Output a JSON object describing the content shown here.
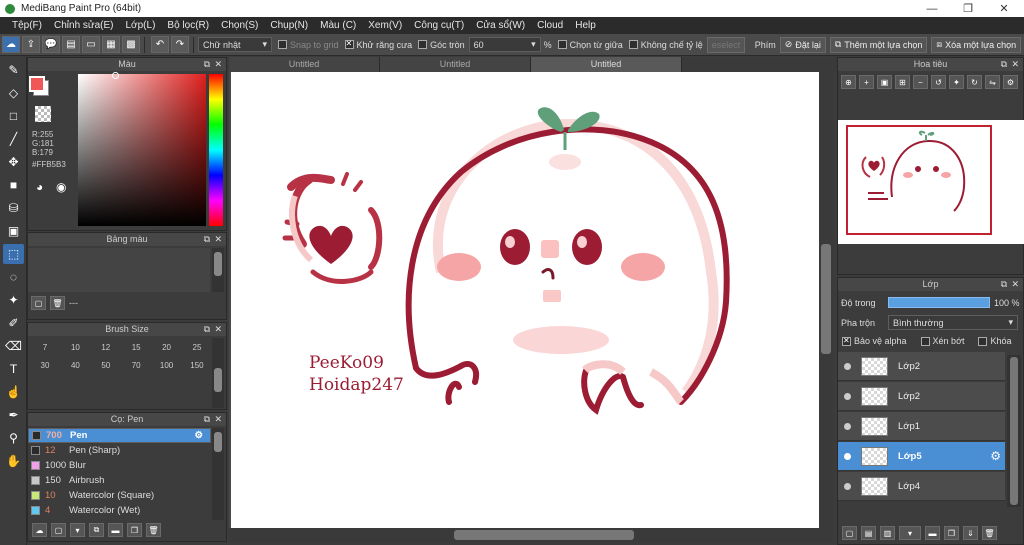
{
  "title": "MediBang Paint Pro (64bit)",
  "menu": [
    "Tệp(F)",
    "Chỉnh sửa(E)",
    "Lớp(L)",
    "Bộ lọc(R)",
    "Chọn(S)",
    "Chụp(N)",
    "Màu (C)",
    "Xem(V)",
    "Công cụ(T)",
    "Cửa sổ(W)",
    "Cloud",
    "Help"
  ],
  "toolbar": {
    "shape_select": "Chữ nhật",
    "snap_to_grid": "Snap to grid",
    "antialias": "Khử răng cưa",
    "round_corner": "Góc tròn",
    "round_value": "60",
    "percent": "%",
    "select_center": "Chọn từ giữa",
    "no_ratio": "Không chế tỷ lệ",
    "deselect": "eselect",
    "shortcut_label": "Phím",
    "reset": "Đặt lại",
    "add_selection": "Thêm một lựa chọn",
    "remove_selection": "Xóa một lựa chọn"
  },
  "color_panel": {
    "title": "Màu",
    "r": "R:255",
    "g": "G:181",
    "b": "B:179",
    "hex": "#FFB5B3",
    "fg": "#f05858",
    "hue": "#e0201e"
  },
  "palette_panel": {
    "title": "Bảng màu",
    "dash": "---"
  },
  "brush_size_panel": {
    "title": "Brush Size",
    "row1": [
      "7",
      "10",
      "12",
      "15",
      "20",
      "25"
    ],
    "row2": [
      "30",
      "40",
      "50",
      "70",
      "100",
      "150"
    ]
  },
  "brush_panel": {
    "title": "Cọ: Pen",
    "items": [
      {
        "size": "700",
        "name": "Pen",
        "color": "#2a2a2a"
      },
      {
        "size": "12",
        "name": "Pen (Sharp)",
        "color": "#2a2a2a"
      },
      {
        "size": "1000",
        "name": "Blur",
        "color": "#f0a0e8"
      },
      {
        "size": "150",
        "name": "Airbrush",
        "color": "#c8c8c8"
      },
      {
        "size": "10",
        "name": "Watercolor (Square)",
        "color": "#c8e878"
      },
      {
        "size": "4",
        "name": "Watercolor (Wet)",
        "color": "#60c8f0"
      }
    ]
  },
  "tabs": [
    "Untitled",
    "Untitled",
    "Untitled"
  ],
  "canvas": {
    "line1": "PeeKo09",
    "line2": "Hoidap247"
  },
  "navigator": {
    "title": "Hoa tiêu"
  },
  "layer_panel": {
    "title": "Lớp",
    "opacity_label": "Độ trong",
    "opacity_value": "100 %",
    "blend_label": "Pha trộn",
    "blend_value": "Bình thường",
    "protect_alpha": "Bảo vệ alpha",
    "clip": "Xén bớt",
    "lock": "Khóa",
    "layers": [
      "Lớp2",
      "Lớp2",
      "Lớp1",
      "Lớp5",
      "Lớp4"
    ]
  }
}
